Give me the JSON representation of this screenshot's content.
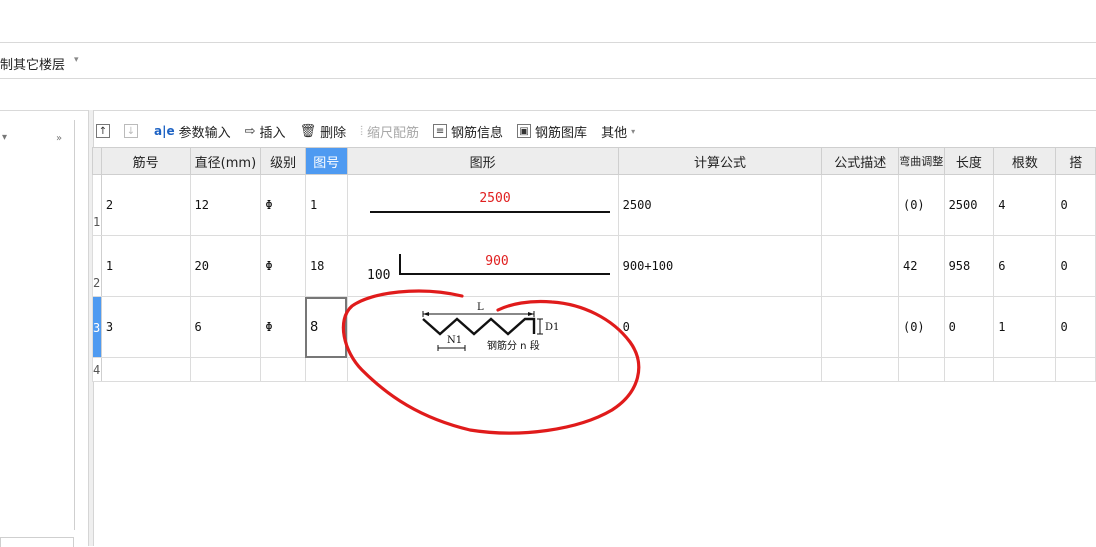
{
  "header": {
    "copy_to_other_floors": "制其它楼层"
  },
  "toolbar": {
    "up_icon": "arrow-up-icon",
    "down_icon": "arrow-down-icon",
    "param_input": "参数输入",
    "insert": "插入",
    "delete": "删除",
    "scale_rebar": "缩尺配筋",
    "rebar_info": "钢筋信息",
    "rebar_library": "钢筋图库",
    "other": "其他",
    "param_glyph": "a|e"
  },
  "grid": {
    "columns": [
      "筋号",
      "直径(mm)",
      "级别",
      "图号",
      "图形",
      "计算公式",
      "公式描述",
      "弯曲调整",
      "长度",
      "根数",
      "搭"
    ],
    "rows": [
      {
        "row_no": "1",
        "bar_no": "2",
        "diameter": "12",
        "grade": "Φ",
        "shape_no": "1",
        "formula": "2500",
        "description": "",
        "bend_adjust": "(0)",
        "length": "2500",
        "count": "4",
        "lap": "0",
        "shape": {
          "main_label": "2500"
        }
      },
      {
        "row_no": "2",
        "bar_no": "1",
        "diameter": "20",
        "grade": "Φ",
        "shape_no": "18",
        "formula": "900+100",
        "description": "",
        "bend_adjust": "42",
        "length": "958",
        "count": "6",
        "lap": "0",
        "shape": {
          "main_label": "900",
          "hook_label": "100"
        }
      },
      {
        "row_no": "3",
        "bar_no": "3",
        "diameter": "6",
        "grade": "Φ",
        "shape_no": "8",
        "formula": "0",
        "description": "",
        "bend_adjust": "(0)",
        "length": "0",
        "count": "1",
        "lap": "0",
        "shape": {
          "label_l": "L",
          "label_d1": "D1",
          "label_n1": "N1",
          "label_segments": "钢筋分 n 段"
        }
      },
      {
        "row_no": "4",
        "bar_no": "",
        "diameter": "",
        "grade": "",
        "shape_no": "",
        "formula": "",
        "description": "",
        "bend_adjust": "",
        "length": "",
        "count": "",
        "lap": ""
      }
    ]
  },
  "colors": {
    "accent": "#4e9af1",
    "dimension_red": "#e02020",
    "annotation_red": "#e01b1b"
  }
}
